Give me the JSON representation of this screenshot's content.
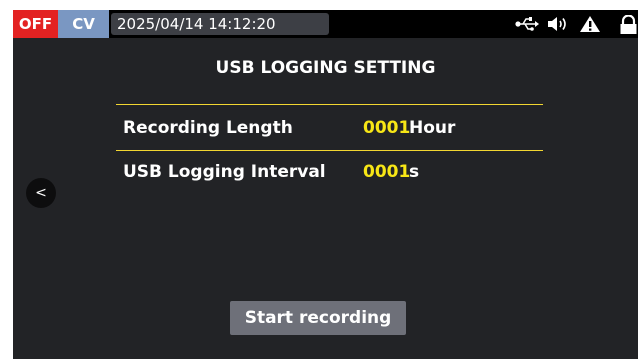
{
  "status_bar": {
    "output_state": "OFF",
    "mode": "CV",
    "datetime": "2025/04/14 14:12:20",
    "icons": [
      "usb-icon",
      "speaker-icon",
      "warning-icon",
      "lock-icon"
    ]
  },
  "page": {
    "title": "USB LOGGING SETTING"
  },
  "settings": {
    "recording_length": {
      "label": "Recording Length",
      "value": "0001",
      "unit": "Hour"
    },
    "logging_interval": {
      "label": "USB Logging Interval",
      "value": "0001",
      "unit": "s"
    }
  },
  "back_button": {
    "glyph": "<"
  },
  "start_button": {
    "label": "Start recording"
  },
  "colors": {
    "off_badge": "#e32222",
    "cv_badge": "#7a97c2",
    "value_yellow": "#f7e616",
    "divider": "#f2d631",
    "background": "#222326",
    "button": "#6e7079"
  }
}
